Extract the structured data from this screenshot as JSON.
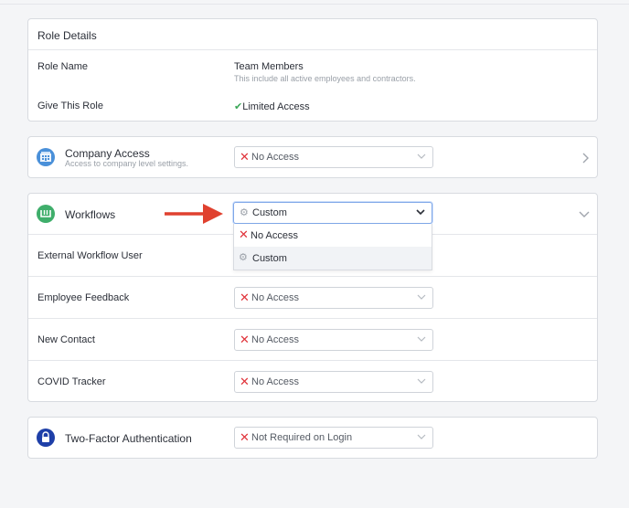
{
  "role_details": {
    "header": "Role Details",
    "role_name_label": "Role Name",
    "role_name_value": "Team Members",
    "role_name_desc": "This include all active employees and contractors.",
    "give_role_label": "Give This Role",
    "give_role_value": "Limited Access"
  },
  "company_access": {
    "title": "Company Access",
    "desc": "Access to company level settings.",
    "value": "No Access",
    "icon": "building-icon"
  },
  "workflows": {
    "title": "Workflows",
    "value": "Custom",
    "icon": "workflow-icon",
    "dropdown_options": [
      "No Access",
      "Custom"
    ],
    "rows": [
      {
        "label": "External Workflow User"
      },
      {
        "label": "Employee Feedback",
        "value": "No Access"
      },
      {
        "label": "New Contact",
        "value": "No Access"
      },
      {
        "label": "COVID Tracker",
        "value": "No Access"
      }
    ]
  },
  "two_factor": {
    "title": "Two-Factor Authentication",
    "value": "Not Required on Login",
    "icon": "lock-icon"
  },
  "colors": {
    "no_access_x": "#e0333a",
    "check_green": "#3aa757",
    "arrow": "#e0412f",
    "accent_border": "#7fa7e8"
  }
}
